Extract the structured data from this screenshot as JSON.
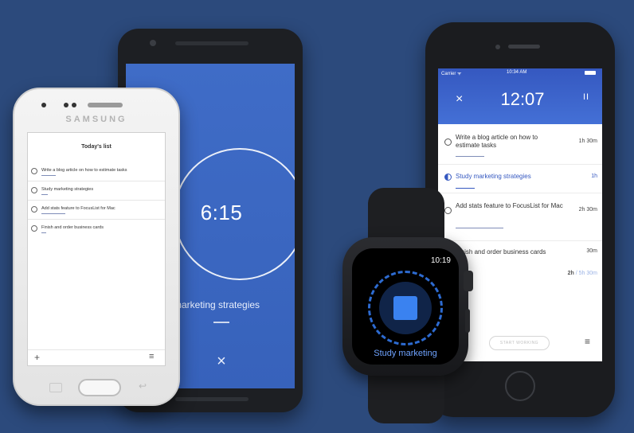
{
  "android": {
    "timer": "6:15",
    "task": "marketing strategies",
    "close_icon": "×",
    "check_icon": "check-icon"
  },
  "samsung": {
    "brand": "SAMSUNG",
    "title": "Today's list",
    "items": [
      {
        "label": "Write a blog article on how to estimate tasks"
      },
      {
        "label": "Study marketing strategies"
      },
      {
        "label": "Add stats feature to FocusList for Mac"
      },
      {
        "label": "Finish and order business cards"
      }
    ],
    "add_icon": "+",
    "menu_icon": "≡"
  },
  "iphone": {
    "status": {
      "carrier": "Carrier ᯤ",
      "time": "10:34 AM"
    },
    "close_icon": "×",
    "timer": "12:07",
    "pause_icon": "II",
    "items": [
      {
        "label": "Write a blog article on how to estimate tasks",
        "duration": "1h 30m",
        "active": false
      },
      {
        "label": "Study marketing strategies",
        "duration": "1h",
        "active": true
      },
      {
        "label": "Add stats feature to FocusList for Mac",
        "duration": "2h 30m",
        "active": false
      },
      {
        "label": "Finish and order business cards",
        "duration": "30m",
        "active": false
      }
    ],
    "total_done": "2h",
    "total_planned": "/ 5h 30m",
    "start_label": "START WORKING",
    "menu_icon": "≡"
  },
  "watch": {
    "time": "10:19",
    "label": "Study marketing",
    "stop_icon": "stop-icon"
  }
}
